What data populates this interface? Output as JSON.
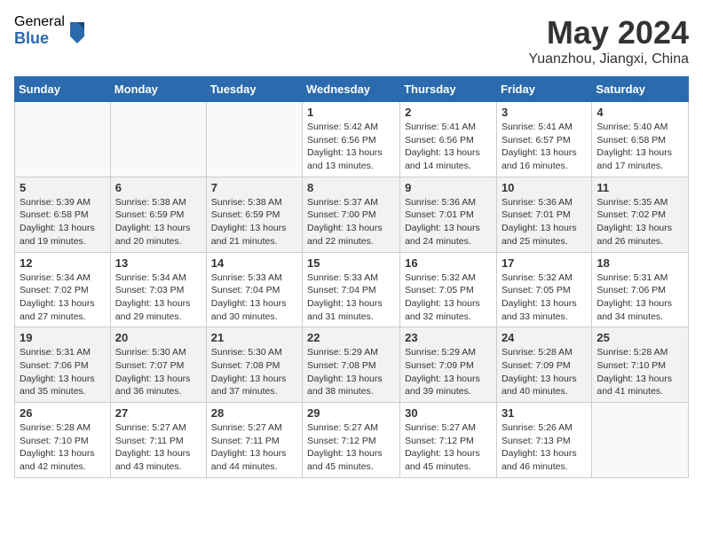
{
  "header": {
    "logo_general": "General",
    "logo_blue": "Blue",
    "month_title": "May 2024",
    "location": "Yuanzhou, Jiangxi, China"
  },
  "days_of_week": [
    "Sunday",
    "Monday",
    "Tuesday",
    "Wednesday",
    "Thursday",
    "Friday",
    "Saturday"
  ],
  "weeks": [
    {
      "cells": [
        {
          "day": "",
          "content": ""
        },
        {
          "day": "",
          "content": ""
        },
        {
          "day": "",
          "content": ""
        },
        {
          "day": "1",
          "content": "Sunrise: 5:42 AM\nSunset: 6:56 PM\nDaylight: 13 hours\nand 13 minutes."
        },
        {
          "day": "2",
          "content": "Sunrise: 5:41 AM\nSunset: 6:56 PM\nDaylight: 13 hours\nand 14 minutes."
        },
        {
          "day": "3",
          "content": "Sunrise: 5:41 AM\nSunset: 6:57 PM\nDaylight: 13 hours\nand 16 minutes."
        },
        {
          "day": "4",
          "content": "Sunrise: 5:40 AM\nSunset: 6:58 PM\nDaylight: 13 hours\nand 17 minutes."
        }
      ]
    },
    {
      "cells": [
        {
          "day": "5",
          "content": "Sunrise: 5:39 AM\nSunset: 6:58 PM\nDaylight: 13 hours\nand 19 minutes."
        },
        {
          "day": "6",
          "content": "Sunrise: 5:38 AM\nSunset: 6:59 PM\nDaylight: 13 hours\nand 20 minutes."
        },
        {
          "day": "7",
          "content": "Sunrise: 5:38 AM\nSunset: 6:59 PM\nDaylight: 13 hours\nand 21 minutes."
        },
        {
          "day": "8",
          "content": "Sunrise: 5:37 AM\nSunset: 7:00 PM\nDaylight: 13 hours\nand 22 minutes."
        },
        {
          "day": "9",
          "content": "Sunrise: 5:36 AM\nSunset: 7:01 PM\nDaylight: 13 hours\nand 24 minutes."
        },
        {
          "day": "10",
          "content": "Sunrise: 5:36 AM\nSunset: 7:01 PM\nDaylight: 13 hours\nand 25 minutes."
        },
        {
          "day": "11",
          "content": "Sunrise: 5:35 AM\nSunset: 7:02 PM\nDaylight: 13 hours\nand 26 minutes."
        }
      ]
    },
    {
      "cells": [
        {
          "day": "12",
          "content": "Sunrise: 5:34 AM\nSunset: 7:02 PM\nDaylight: 13 hours\nand 27 minutes."
        },
        {
          "day": "13",
          "content": "Sunrise: 5:34 AM\nSunset: 7:03 PM\nDaylight: 13 hours\nand 29 minutes."
        },
        {
          "day": "14",
          "content": "Sunrise: 5:33 AM\nSunset: 7:04 PM\nDaylight: 13 hours\nand 30 minutes."
        },
        {
          "day": "15",
          "content": "Sunrise: 5:33 AM\nSunset: 7:04 PM\nDaylight: 13 hours\nand 31 minutes."
        },
        {
          "day": "16",
          "content": "Sunrise: 5:32 AM\nSunset: 7:05 PM\nDaylight: 13 hours\nand 32 minutes."
        },
        {
          "day": "17",
          "content": "Sunrise: 5:32 AM\nSunset: 7:05 PM\nDaylight: 13 hours\nand 33 minutes."
        },
        {
          "day": "18",
          "content": "Sunrise: 5:31 AM\nSunset: 7:06 PM\nDaylight: 13 hours\nand 34 minutes."
        }
      ]
    },
    {
      "cells": [
        {
          "day": "19",
          "content": "Sunrise: 5:31 AM\nSunset: 7:06 PM\nDaylight: 13 hours\nand 35 minutes."
        },
        {
          "day": "20",
          "content": "Sunrise: 5:30 AM\nSunset: 7:07 PM\nDaylight: 13 hours\nand 36 minutes."
        },
        {
          "day": "21",
          "content": "Sunrise: 5:30 AM\nSunset: 7:08 PM\nDaylight: 13 hours\nand 37 minutes."
        },
        {
          "day": "22",
          "content": "Sunrise: 5:29 AM\nSunset: 7:08 PM\nDaylight: 13 hours\nand 38 minutes."
        },
        {
          "day": "23",
          "content": "Sunrise: 5:29 AM\nSunset: 7:09 PM\nDaylight: 13 hours\nand 39 minutes."
        },
        {
          "day": "24",
          "content": "Sunrise: 5:28 AM\nSunset: 7:09 PM\nDaylight: 13 hours\nand 40 minutes."
        },
        {
          "day": "25",
          "content": "Sunrise: 5:28 AM\nSunset: 7:10 PM\nDaylight: 13 hours\nand 41 minutes."
        }
      ]
    },
    {
      "cells": [
        {
          "day": "26",
          "content": "Sunrise: 5:28 AM\nSunset: 7:10 PM\nDaylight: 13 hours\nand 42 minutes."
        },
        {
          "day": "27",
          "content": "Sunrise: 5:27 AM\nSunset: 7:11 PM\nDaylight: 13 hours\nand 43 minutes."
        },
        {
          "day": "28",
          "content": "Sunrise: 5:27 AM\nSunset: 7:11 PM\nDaylight: 13 hours\nand 44 minutes."
        },
        {
          "day": "29",
          "content": "Sunrise: 5:27 AM\nSunset: 7:12 PM\nDaylight: 13 hours\nand 45 minutes."
        },
        {
          "day": "30",
          "content": "Sunrise: 5:27 AM\nSunset: 7:12 PM\nDaylight: 13 hours\nand 45 minutes."
        },
        {
          "day": "31",
          "content": "Sunrise: 5:26 AM\nSunset: 7:13 PM\nDaylight: 13 hours\nand 46 minutes."
        },
        {
          "day": "",
          "content": ""
        }
      ]
    }
  ]
}
